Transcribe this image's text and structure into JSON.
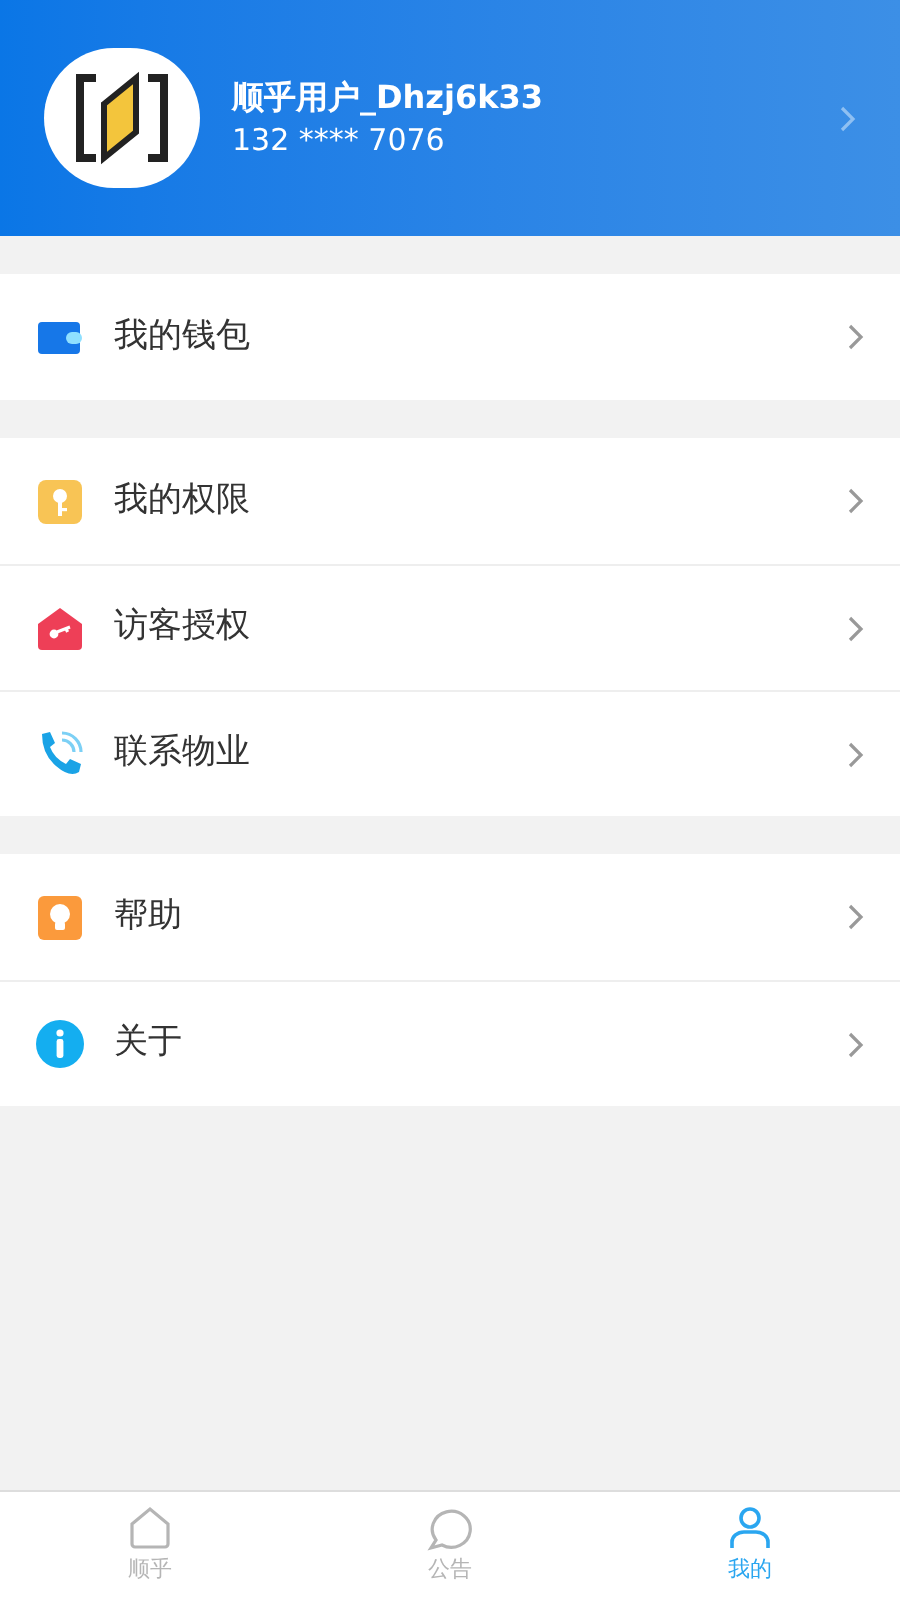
{
  "profile": {
    "name": "顺乎用户_Dhzj6k33",
    "phone": "132 **** 7076"
  },
  "groups": [
    {
      "items": [
        {
          "kind": "wallet",
          "label": "我的钱包"
        }
      ]
    },
    {
      "items": [
        {
          "kind": "key",
          "label": "我的权限"
        },
        {
          "kind": "visitor",
          "label": "访客授权"
        },
        {
          "kind": "phone",
          "label": "联系物业"
        }
      ]
    },
    {
      "items": [
        {
          "kind": "bulb",
          "label": "帮助"
        },
        {
          "kind": "info",
          "label": "关于"
        }
      ]
    }
  ],
  "tabs": [
    {
      "kind": "home",
      "label": "顺乎",
      "selected": false
    },
    {
      "kind": "chat",
      "label": "公告",
      "selected": false
    },
    {
      "kind": "user",
      "label": "我的",
      "selected": true
    }
  ]
}
